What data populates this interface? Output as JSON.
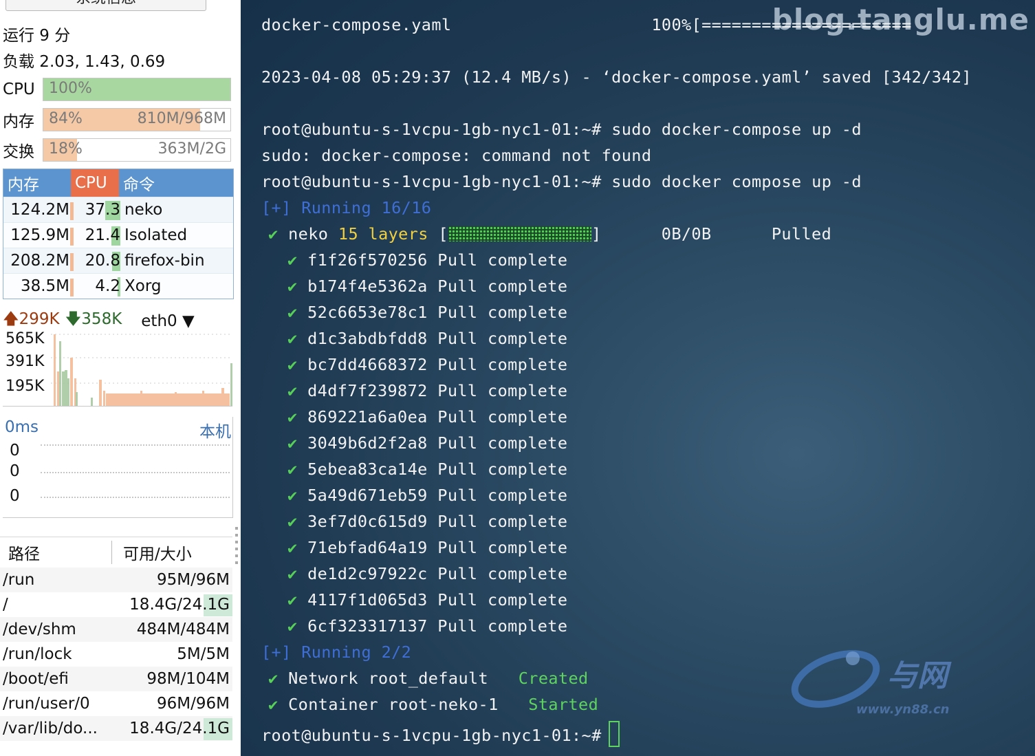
{
  "sidebar": {
    "top_button": "系统信息",
    "uptime": "运行 9 分",
    "load": "负载 2.03, 1.43, 0.69",
    "meters": [
      {
        "label": "CPU",
        "percent": "100%",
        "amount": "",
        "fill": 1.0,
        "color": "#a8d8a0"
      },
      {
        "label": "内存",
        "percent": "84%",
        "amount": "810M/968M",
        "fill": 0.84,
        "color": "#f5c9a6"
      },
      {
        "label": "交换",
        "percent": "18%",
        "amount": "363M/2G",
        "fill": 0.18,
        "color": "#f5c9a6"
      }
    ],
    "process_table": {
      "headers": [
        "内存",
        "CPU",
        "命令"
      ],
      "rows": [
        {
          "mem": "124.2M",
          "cpu": "37.3",
          "cmd": "neko",
          "cpu_fill": 0.373
        },
        {
          "mem": "125.9M",
          "cpu": "21.4",
          "cmd": "Isolated",
          "cpu_fill": 0.214
        },
        {
          "mem": "208.2M",
          "cpu": "20.8",
          "cmd": "firefox-bin",
          "cpu_fill": 0.208
        },
        {
          "mem": "38.5M",
          "cpu": "4.2",
          "cmd": "Xorg",
          "cpu_fill": 0.042
        }
      ]
    },
    "network": {
      "up": "299K",
      "down": "358K",
      "interface": "eth0",
      "y_labels": [
        "565K",
        "391K",
        "195K"
      ]
    },
    "ping": {
      "latency": "0ms",
      "location": "本机",
      "values": [
        "0",
        "0",
        "0"
      ]
    },
    "disks": {
      "headers": [
        "路径",
        "可用/大小"
      ],
      "rows": [
        {
          "path": "/run",
          "size": "95M/96M"
        },
        {
          "path": "/",
          "size": "18.4G/24.1G"
        },
        {
          "path": "/dev/shm",
          "size": "484M/484M"
        },
        {
          "path": "/run/lock",
          "size": "5M/5M"
        },
        {
          "path": "/boot/efi",
          "size": "98M/104M"
        },
        {
          "path": "/run/user/0",
          "size": "96M/96M"
        },
        {
          "path": "/var/lib/do...",
          "size": "18.4G/24.1G"
        }
      ]
    }
  },
  "terminal": {
    "watermark": "blog.tanglu.me",
    "watermark_logo": "与网 www.yn88.cn",
    "line_download": "docker-compose.yaml                    100%[=====================",
    "line_saved": "2023-04-08 05:29:37 (12.4 MB/s) - ‘docker-compose.yaml’ saved [342/342]",
    "prompt": "root@ubuntu-s-1vcpu-1gb-nyc1-01:~#",
    "cmd1": " sudo docker-compose up -d",
    "err1": "sudo: docker-compose: command not found",
    "cmd2": " sudo docker compose up -d",
    "running1": "[+] Running 16/16",
    "neko_name": "neko",
    "neko_layers": "15 layers",
    "neko_size": "0B/0B",
    "neko_status": "Pulled",
    "check": "✔",
    "pull_complete": "Pull complete",
    "layers": [
      "f1f26f570256",
      "b174f4e5362a",
      "52c6653e78c1",
      "d1c3abdbfdd8",
      "bc7dd4668372",
      "d4df7f239872",
      "869221a6a0ea",
      "3049b6d2f2a8",
      "5ebea83ca14e",
      "5a49d671eb59",
      "3ef7d0c615d9",
      "71ebfad64a19",
      "de1d2c97922c",
      "4117f1d065d3",
      "6cf323317137"
    ],
    "running2": "[+] Running 2/2",
    "network_line": "Network root_default",
    "network_status": "Created",
    "container_line": "Container root-neko-1",
    "container_status": "Started"
  }
}
